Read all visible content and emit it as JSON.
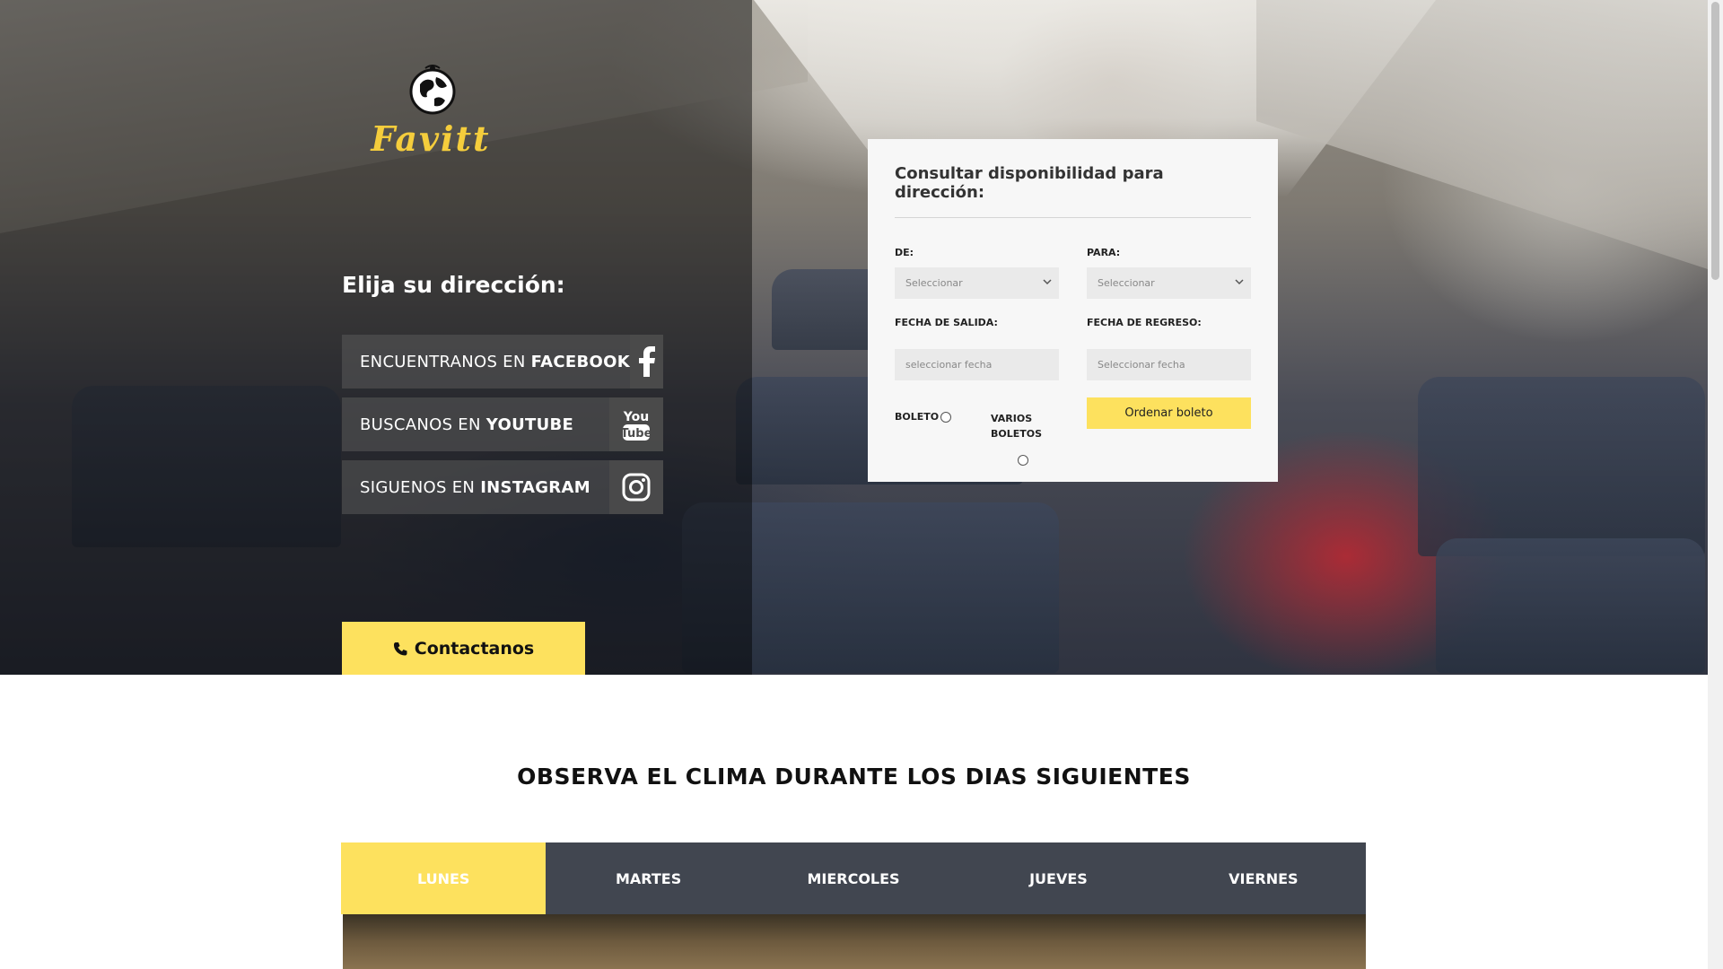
{
  "brand": {
    "name": "Favitt",
    "logo_icon": "globe-icon",
    "color": "#f5cd3c"
  },
  "left_panel": {
    "heading": "Elija su dirección:",
    "social": [
      {
        "prefix": "ENCUENTRANOS EN",
        "network": "FACEBOOK",
        "icon": "facebook-icon"
      },
      {
        "prefix": "BUSCANOS EN",
        "network": "YOUTUBE",
        "icon": "youtube-icon"
      },
      {
        "prefix": "SIGUENOS EN",
        "network": "INSTAGRAM",
        "icon": "instagram-icon"
      }
    ],
    "contact_button": {
      "label": "Contactanos",
      "icon": "phone-icon"
    }
  },
  "booking_form": {
    "title": "Consultar disponibilidad para dirección:",
    "from": {
      "label": "DE:",
      "value": "Seleccionar"
    },
    "to": {
      "label": "PARA:",
      "value": "Seleccionar"
    },
    "departure": {
      "label": "FECHA DE SALIDA:",
      "placeholder": "seleccionar fecha"
    },
    "return": {
      "label": "FECHA DE REGRESO:",
      "placeholder": "Seleccionar fecha"
    },
    "ticket_options": [
      {
        "label": "BOLETO",
        "checked": false
      },
      {
        "label": "VARIOS BOLETOS",
        "checked": false
      }
    ],
    "submit_label": "Ordenar boleto"
  },
  "weather": {
    "title": "OBSERVA EL CLIMA DURANTE LOS DIAS SIGUIENTES",
    "tabs": [
      "LUNES",
      "MARTES",
      "MIERCOLES",
      "JUEVES",
      "VIERNES"
    ],
    "active_tab": "LUNES"
  },
  "colors": {
    "accent": "#fde15e",
    "tab_bar": "#414650",
    "form_bg": "#f7f7f7"
  }
}
